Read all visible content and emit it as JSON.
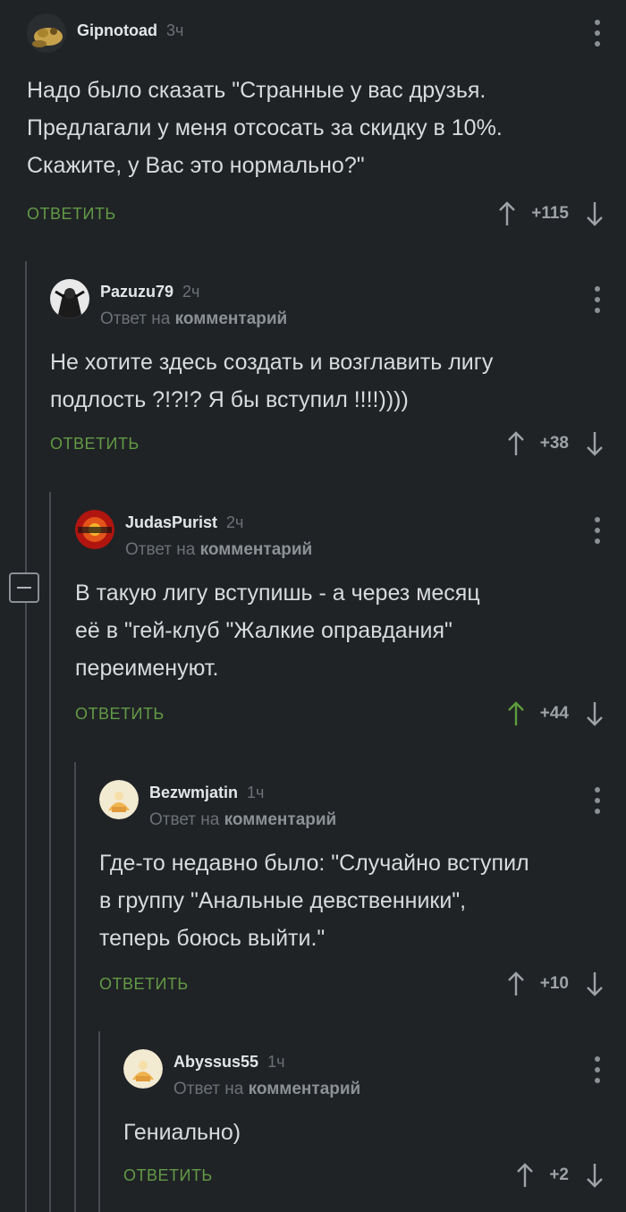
{
  "reply_label": "ОТВЕТИТЬ",
  "reply_to_prefix": "Ответ на",
  "reply_to_target": "комментарий",
  "colors": {
    "background": "#202326",
    "reply_green": "#629a45",
    "upvoted_green": "#5d9c3c",
    "muted": "#6c7176"
  },
  "comments": [
    {
      "username": "Gipnotoad",
      "time": "3ч",
      "text": "Надо было сказать \"Странные у вас друзья.\nПредлагали у меня отсосать за скидку в 10%.\nСкажите, у Вас это нормально?\"",
      "score": "+115",
      "avatar_icon": "toad-avatar-icon"
    },
    {
      "username": "Pazuzu79",
      "time": "2ч",
      "text": "Не хотите здесь создать и возглавить лигу\nподлость ?!?!? Я бы вступил !!!!))))",
      "score": "+38",
      "avatar_icon": "dark-figure-avatar-icon"
    },
    {
      "username": "JudasPurist",
      "time": "2ч",
      "text": "В такую лигу вступишь - а через месяц\nеё в \"гей-клуб \"Жалкие оправдания\"\nпереименуют.",
      "score": "+44",
      "avatar_icon": "fire-logo-avatar-icon",
      "upvoted": true
    },
    {
      "username": "Bezwmjatin",
      "time": "1ч",
      "text": "Где-то недавно было: \"Случайно вступил\nв группу \"Анальные девственники\",\nтеперь боюсь выйти.\"",
      "score": "+10",
      "avatar_icon": "default-chef-avatar-icon"
    },
    {
      "username": "Abyssus55",
      "time": "1ч",
      "text": "Гениально)",
      "score": "+2",
      "avatar_icon": "default-chef-avatar-icon"
    }
  ]
}
